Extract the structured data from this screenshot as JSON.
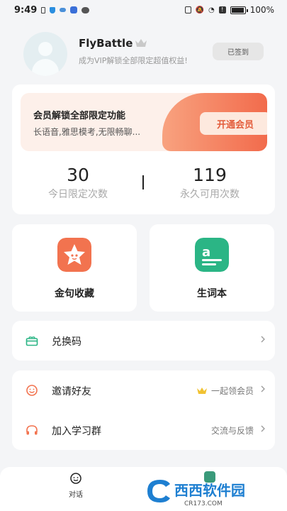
{
  "status_bar": {
    "time": "9:49",
    "battery": "100%",
    "battery_level": 1.0
  },
  "profile": {
    "username": "FlyBattle",
    "vip_tip": "成为VIP解锁全部限定超值权益!",
    "signin_label": "已签到"
  },
  "vip_card": {
    "title": "会员解锁全部限定功能",
    "subtitle": "长语音,雅思模考,无限畅聊...",
    "button_label": "开通会员",
    "accent": "#f26b4c"
  },
  "counts": {
    "today_value": "30",
    "today_label": "今日限定次数",
    "permanent_value": "119",
    "permanent_label": "永久可用次数"
  },
  "tiles": {
    "quotes_label": "金句收藏",
    "vocab_label": "生词本"
  },
  "list": {
    "redeem_label": "兑换码",
    "invite_label": "邀请好友",
    "invite_right": "一起领会员",
    "group_label": "加入学习群",
    "group_right": "交流与反馈"
  },
  "bottom_nav": {
    "chat_label": "对话"
  },
  "watermark": {
    "brand": "西西软件园",
    "url": "CR173.COM"
  }
}
